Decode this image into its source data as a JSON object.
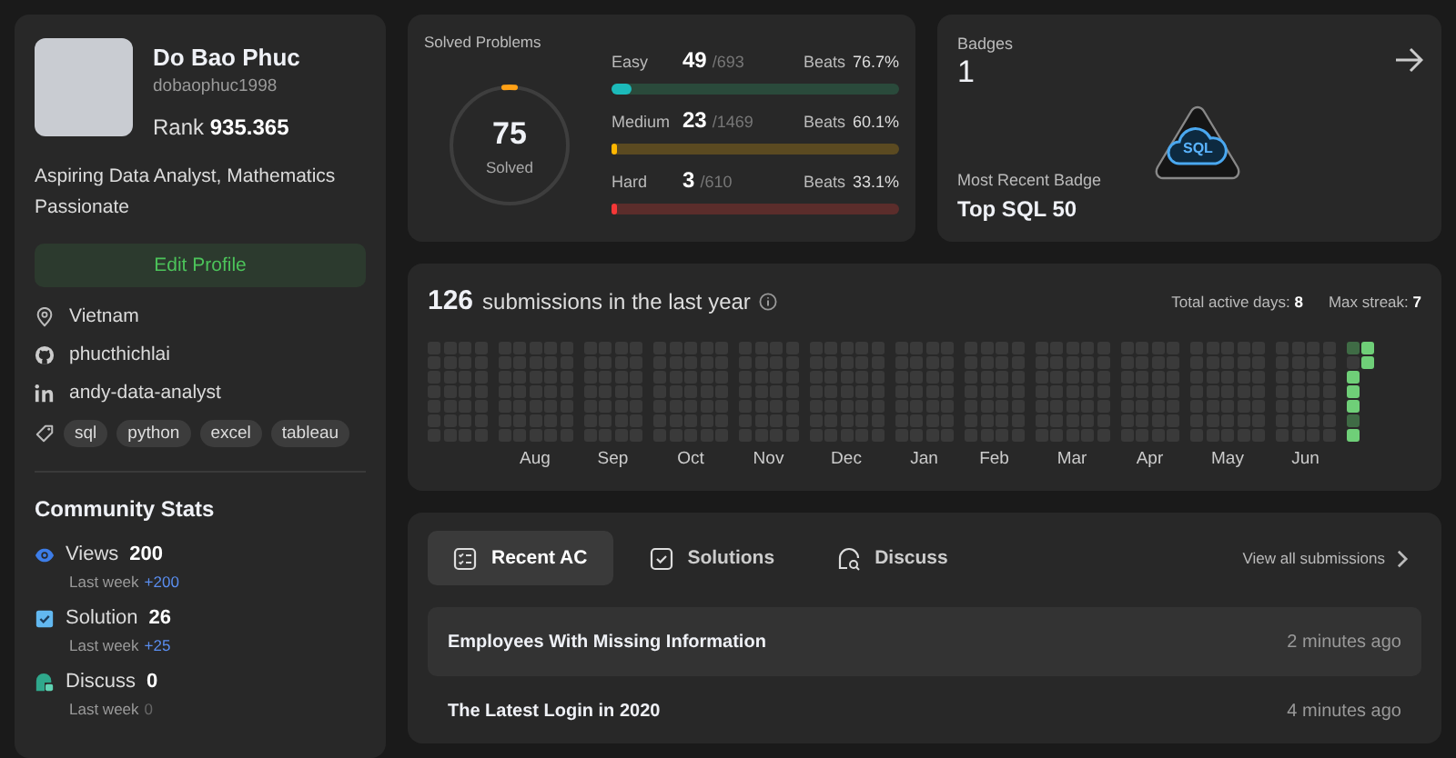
{
  "profile": {
    "name": "Do Bao Phuc",
    "username": "dobaophuc1998",
    "rank_label": "Rank",
    "rank": "935.365",
    "bio": "Aspiring Data Analyst, Mathematics Passionate",
    "edit_button": "Edit Profile",
    "links": [
      {
        "kind": "location",
        "text": "Vietnam"
      },
      {
        "kind": "github",
        "text": "phucthichlai"
      },
      {
        "kind": "linkedin",
        "text": "andy-data-analyst"
      }
    ],
    "tags": [
      "sql",
      "python",
      "excel",
      "tableau"
    ]
  },
  "community_stats": {
    "title": "Community Stats",
    "items": [
      {
        "kind": "views",
        "label": "Views",
        "value": "200",
        "period": "Last week",
        "change": "+200",
        "highlighted": true
      },
      {
        "kind": "solution",
        "label": "Solution",
        "value": "26",
        "period": "Last week",
        "change": "+25",
        "highlighted": true
      },
      {
        "kind": "discuss",
        "label": "Discuss",
        "value": "0",
        "period": "Last week",
        "change": "0",
        "highlighted": false
      }
    ]
  },
  "solved": {
    "title": "Solved Problems",
    "total": "75",
    "total_label": "Solved",
    "level": 0.03,
    "difficulties": [
      {
        "kind": "easy",
        "label": "Easy",
        "count": "49",
        "total": "/693",
        "beats_label": "Beats",
        "beats": "76.7%",
        "level": 0.07
      },
      {
        "kind": "medium",
        "label": "Medium",
        "count": "23",
        "total": "/1469",
        "beats_label": "Beats",
        "beats": "60.1%",
        "level": 0.016
      },
      {
        "kind": "hard",
        "label": "Hard",
        "count": "3",
        "total": "/610",
        "beats_label": "Beats",
        "beats": "33.1%",
        "level": 0.006
      }
    ]
  },
  "badges": {
    "title": "Badges",
    "count": "1",
    "badge_label": "SQL",
    "recent_label": "Most Recent Badge",
    "recent": "Top SQL 50"
  },
  "submissions": {
    "count": "126",
    "label": "submissions in the last year",
    "active_days": "Total active days: **8**",
    "max_streak": "Max streak: **7**",
    "months": [
      "Aug",
      "Sep",
      "Oct",
      "Nov",
      "Dec",
      "Jan",
      "Feb",
      "Mar",
      "Apr",
      "May",
      "Jun"
    ],
    "recent_days": [
      {
        "color": "#3f6b45"
      },
      {
        "color": "#3a3a3a"
      },
      {
        "color": "#6fcf78"
      },
      {
        "color": "#6fcf78"
      },
      {
        "color": "#6fcf78"
      },
      {
        "color": "#3f6b45"
      },
      {
        "color": "#6fcf78"
      },
      {
        "color": "#6fcf78"
      },
      {
        "color": "#6fcf78"
      }
    ]
  },
  "activity": {
    "tabs": [
      {
        "kind": "recent",
        "label": "Recent AC",
        "selected": true
      },
      {
        "kind": "solutions",
        "label": "Solutions",
        "selected": false
      },
      {
        "kind": "discuss",
        "label": "Discuss",
        "selected": false
      }
    ],
    "view_all": "View all submissions",
    "rows": [
      {
        "title": "Employees With Missing Information",
        "time": "2 minutes ago"
      },
      {
        "title": "The Latest Login in 2020",
        "time": "4 minutes ago"
      }
    ]
  }
}
